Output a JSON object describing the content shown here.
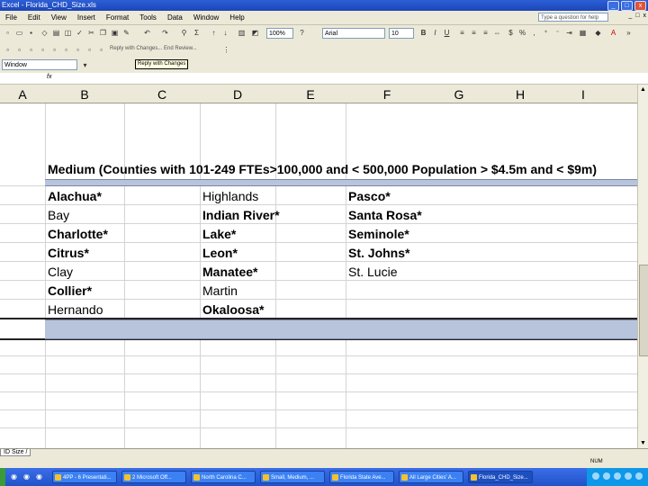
{
  "window": {
    "title": "Excel - Florida_CHD_Size.xls",
    "controls": [
      "_",
      "□",
      "x"
    ]
  },
  "menubar": {
    "items": [
      "File",
      "Edit",
      "View",
      "Insert",
      "Format",
      "Tools",
      "Data",
      "Window",
      "Help"
    ],
    "help_placeholder": "Type a question for help",
    "doc_controls": [
      "_",
      "□",
      "x"
    ]
  },
  "toolbar": {
    "zoom": "100%",
    "font": "Arial",
    "font_size": "10",
    "reply_text": "Reply with Changes... End Review...",
    "tooltip": "Reply with Changes"
  },
  "namebox": {
    "value": "Window"
  },
  "formula_bar": {
    "fx": "fx"
  },
  "columns": [
    "A",
    "B",
    "C",
    "D",
    "E",
    "F",
    "G",
    "H",
    "I"
  ],
  "sheet": {
    "heading": "Medium (Counties with 101-249 FTEs>100,000 and < 500,000 Population > $4.5m and < $9m)",
    "col_b": [
      {
        "text": "Alachua*",
        "bold": true
      },
      {
        "text": "Bay",
        "bold": false
      },
      {
        "text": "Charlotte*",
        "bold": true
      },
      {
        "text": "Citrus*",
        "bold": true
      },
      {
        "text": "Clay",
        "bold": false
      },
      {
        "text": "Collier*",
        "bold": true
      },
      {
        "text": "Hernando",
        "bold": false
      }
    ],
    "col_d": [
      {
        "text": "Highlands",
        "bold": false
      },
      {
        "text": "Indian River*",
        "bold": true
      },
      {
        "text": "Lake*",
        "bold": true
      },
      {
        "text": "Leon*",
        "bold": true
      },
      {
        "text": "Manatee*",
        "bold": true
      },
      {
        "text": "Martin",
        "bold": false
      },
      {
        "text": "Okaloosa*",
        "bold": true
      }
    ],
    "col_f": [
      {
        "text": "Pasco*",
        "bold": true
      },
      {
        "text": "Santa Rosa*",
        "bold": true
      },
      {
        "text": "Seminole*",
        "bold": true
      },
      {
        "text": "St. Johns*",
        "bold": true
      },
      {
        "text": "St. Lucie",
        "bold": false
      }
    ]
  },
  "sheet_tabs": {
    "active": "ID Size /"
  },
  "statusbar": {
    "mode": "NUM"
  },
  "taskbar": {
    "tasks": [
      "4PP - 6 Presentati...",
      "2 Microsoft Off...",
      "North Carolina C...",
      "Small, Medium, ...",
      "Florida State Ave...",
      "All Large Cities' A...",
      "Florida_CHD_Size..."
    ],
    "active_task": 6
  },
  "colors": {
    "band": "#b8c4dc",
    "titlebar": "#2d5fd6",
    "toolbar": "#ece9d8"
  }
}
